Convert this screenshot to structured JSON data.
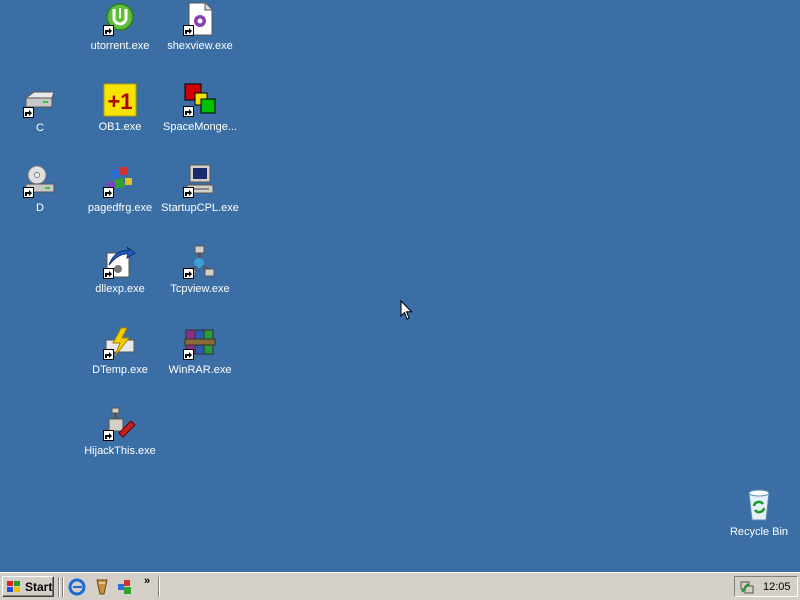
{
  "desktop": {
    "background_color": "#3a6ea5",
    "icons": {
      "utorrent": {
        "label": "utorrent.exe",
        "icon": "utorrent-icon"
      },
      "shexview": {
        "label": "shexview.exe",
        "icon": "shexview-icon"
      },
      "c_drive": {
        "label": "C",
        "icon": "hard-drive-icon"
      },
      "ob1": {
        "label": "OB1.exe",
        "icon": "ob1-icon"
      },
      "spacemonger": {
        "label": "SpaceMonge...",
        "icon": "spacemonger-icon"
      },
      "d_drive": {
        "label": "D",
        "icon": "cd-drive-icon"
      },
      "pagedfrg": {
        "label": "pagedfrg.exe",
        "icon": "pagedfrg-icon"
      },
      "startupcpl": {
        "label": "StartupCPL.exe",
        "icon": "computer-icon"
      },
      "dllexp": {
        "label": "dllexp.exe",
        "icon": "dllexp-icon"
      },
      "tcpview": {
        "label": "Tcpview.exe",
        "icon": "network-icon"
      },
      "dtemp": {
        "label": "DTemp.exe",
        "icon": "dtemp-icon"
      },
      "winrar": {
        "label": "WinRAR.exe",
        "icon": "winrar-icon"
      },
      "hijackthis": {
        "label": "HijackThis.exe",
        "icon": "hijackthis-icon"
      },
      "recycle_bin": {
        "label": "Recycle Bin",
        "icon": "recycle-bin-icon"
      }
    }
  },
  "taskbar": {
    "start_label": "Start",
    "quick_launch": [
      "ie-icon",
      "utorrent-ql-icon",
      "pagedfrg-ql-icon"
    ],
    "more_label": "»",
    "clock": "12:05"
  }
}
